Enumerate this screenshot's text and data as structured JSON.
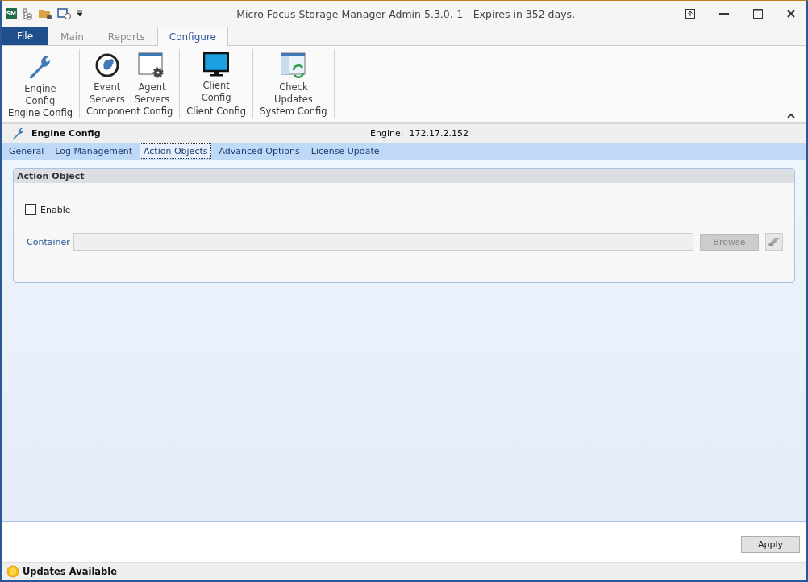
{
  "window": {
    "title": "Micro Focus Storage Manager Admin 5.3.0.-1 - Expires in 352 days.",
    "app_badge": "SM"
  },
  "ribbon_tabs": [
    {
      "label": "File",
      "kind": "file",
      "selected": false
    },
    {
      "label": "Main",
      "kind": "tab",
      "selected": false
    },
    {
      "label": "Reports",
      "kind": "tab",
      "selected": false
    },
    {
      "label": "Configure",
      "kind": "tab",
      "selected": true
    }
  ],
  "ribbon_groups": [
    {
      "label": "Engine Config",
      "buttons": [
        {
          "label": "Engine Config",
          "kind": "wrench"
        }
      ]
    },
    {
      "label": "Component Config",
      "buttons": [
        {
          "label": "Event Servers",
          "kind": "hand"
        },
        {
          "label": "Agent Servers",
          "kind": "window-gear"
        }
      ]
    },
    {
      "label": "Client Config",
      "buttons": [
        {
          "label": "Client Config",
          "kind": "monitor"
        }
      ]
    },
    {
      "label": "System Config",
      "buttons": [
        {
          "label": "Check Updates",
          "kind": "window-refresh"
        }
      ]
    }
  ],
  "page": {
    "title": "Engine Config",
    "engine_label": "Engine:",
    "engine_value": "172.17.2.152"
  },
  "sub_tabs": [
    {
      "label": "General",
      "selected": false
    },
    {
      "label": "Log Management",
      "selected": false
    },
    {
      "label": "Action Objects",
      "selected": true
    },
    {
      "label": "Advanced Options",
      "selected": false
    },
    {
      "label": "License Update",
      "selected": false
    }
  ],
  "section": {
    "title": "Action Object",
    "enable": {
      "label": "Enable",
      "checked": false
    },
    "container": {
      "label": "Container",
      "disabled": true
    },
    "browse_button": {
      "label": "Browse",
      "disabled": true
    },
    "clear_button": {
      "disabled": true
    }
  },
  "apply_button": {
    "label": "Apply"
  },
  "status_bar": {
    "text": "Updates Available"
  }
}
